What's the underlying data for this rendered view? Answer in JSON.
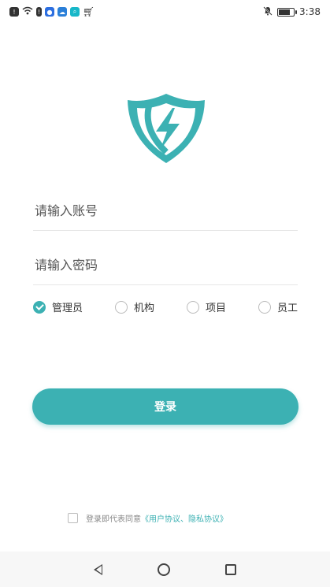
{
  "status_bar": {
    "time": "3:38"
  },
  "username": {
    "placeholder": "请输入账号"
  },
  "password": {
    "placeholder": "请输入密码"
  },
  "roles": [
    {
      "label": "管理员",
      "checked": true
    },
    {
      "label": "机构",
      "checked": false
    },
    {
      "label": "项目",
      "checked": false
    },
    {
      "label": "员工",
      "checked": false
    }
  ],
  "login_button": {
    "label": "登录"
  },
  "agreement": {
    "text": "登录即代表同意",
    "link": "《用户协议、隐私协议》"
  },
  "colors": {
    "accent": "#3cb1b3"
  }
}
